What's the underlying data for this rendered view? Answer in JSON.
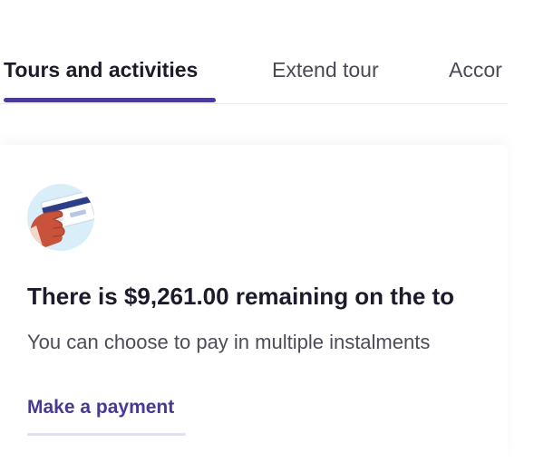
{
  "tabs": [
    {
      "label": "Tours and activities",
      "active": true
    },
    {
      "label": "Extend tour",
      "active": false
    },
    {
      "label": "Accor",
      "active": false
    }
  ],
  "card": {
    "icon": "credit-card-in-hand-icon",
    "title": "There is $9,261.00 remaining on the to",
    "subtitle": "You can choose to pay in multiple instalments",
    "action_label": "Make a payment"
  },
  "colors": {
    "accent": "#4b3a9b",
    "link": "#4a3796",
    "text_primary": "#1c1b2b",
    "text_secondary": "#4c4c58",
    "icon_bg": "#d9eef8"
  }
}
